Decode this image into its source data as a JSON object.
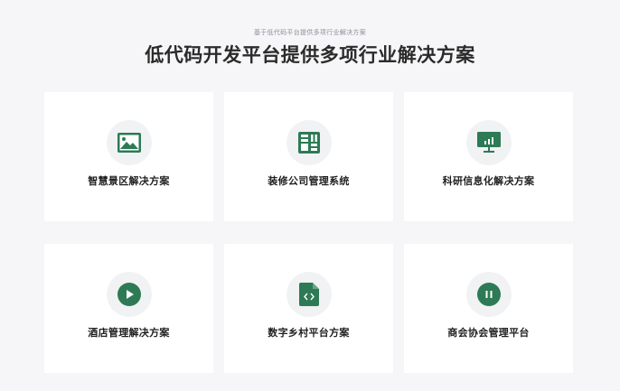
{
  "header": {
    "subtitle": "基于低代码平台提供多项行业解决方案",
    "title": "低代码开发平台提供多项行业解决方案"
  },
  "theme": {
    "icon_color": "#2d7a55",
    "card_bg": "#ffffff",
    "page_bg": "#f6f6f8"
  },
  "solutions": [
    {
      "label": "智慧景区解决方案",
      "icon": "image-icon"
    },
    {
      "label": "装修公司管理系统",
      "icon": "grid-layout-icon"
    },
    {
      "label": "科研信息化解决方案",
      "icon": "monitor-chart-icon"
    },
    {
      "label": "酒店管理解决方案",
      "icon": "play-icon"
    },
    {
      "label": "数字乡村平台方案",
      "icon": "code-file-icon"
    },
    {
      "label": "商会协会管理平台",
      "icon": "pause-icon"
    }
  ]
}
